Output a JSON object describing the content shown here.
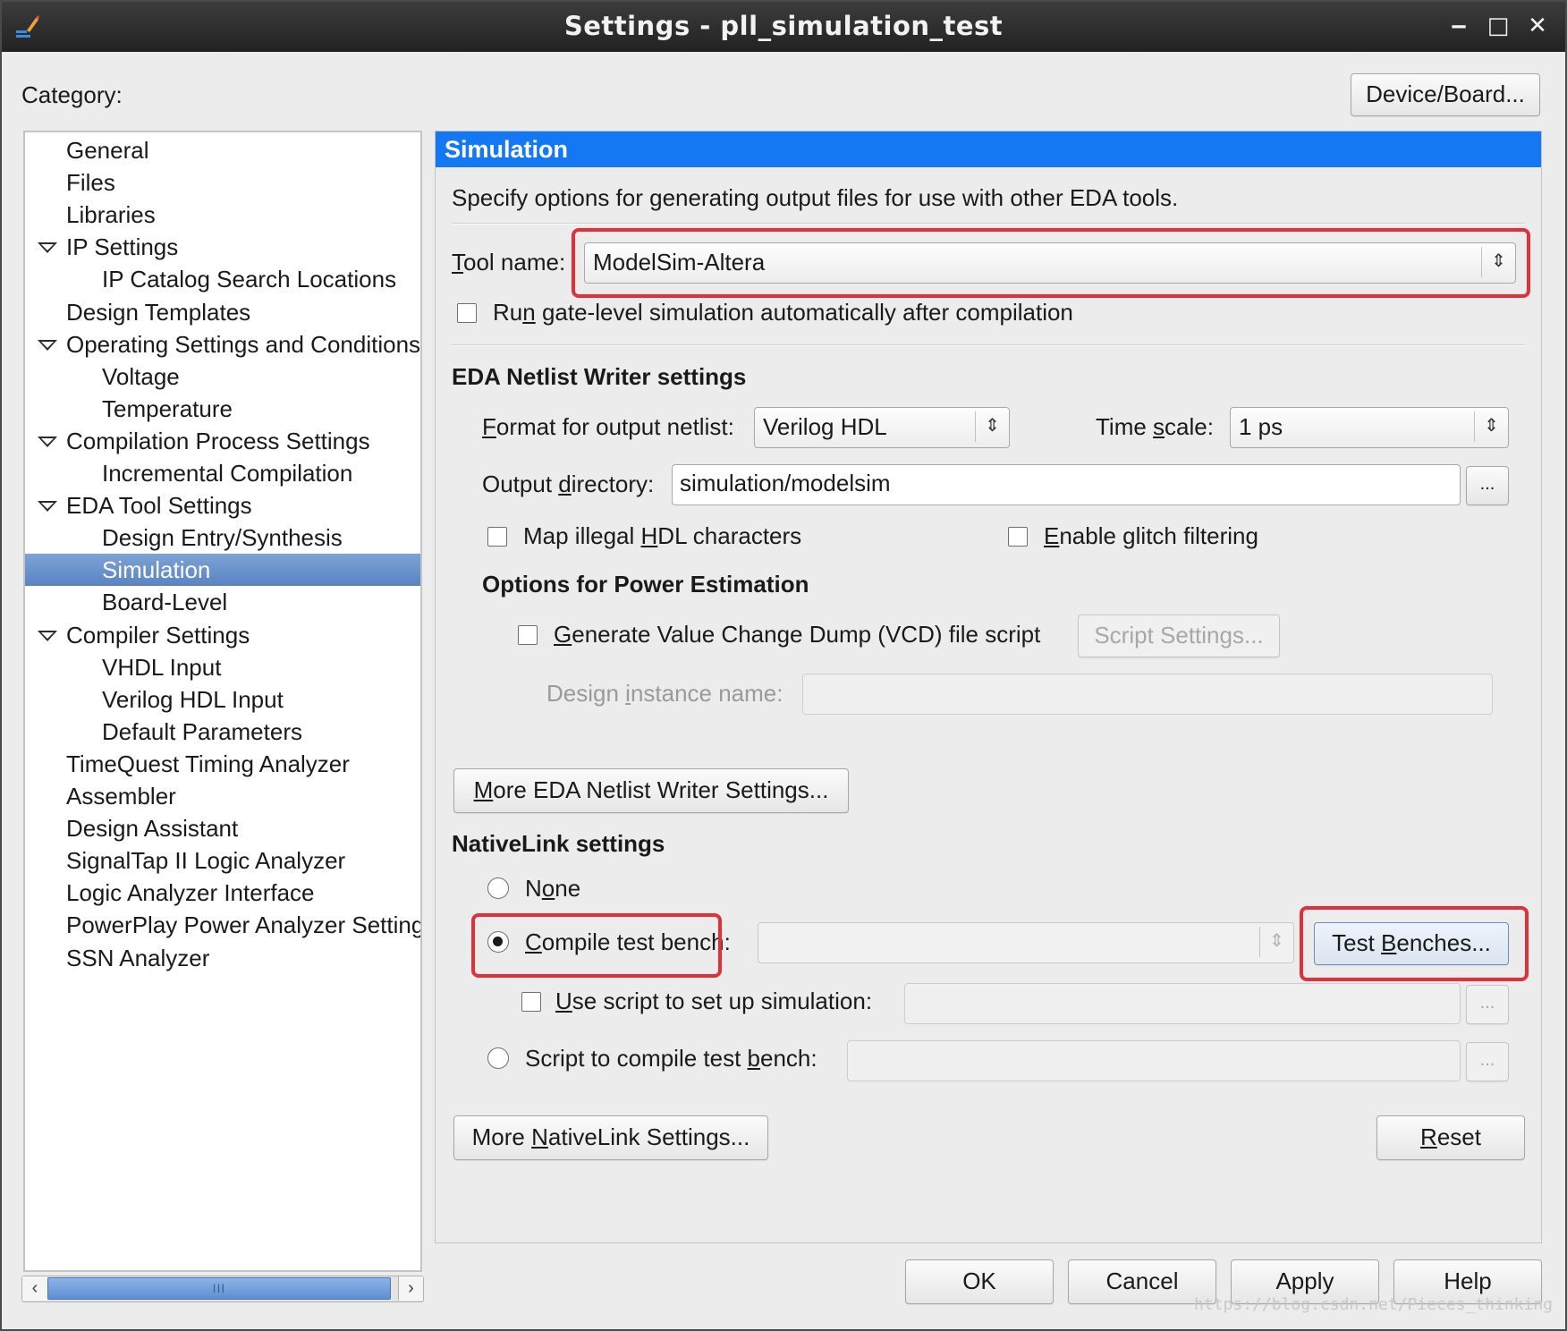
{
  "window": {
    "title": "Settings - pll_simulation_test",
    "minimize_glyph": "‒",
    "maximize_glyph": "□",
    "close_glyph": "✕"
  },
  "category_label": "Category:",
  "device_board_button": "Device/Board...",
  "tree": {
    "items": [
      {
        "label": "General",
        "level": 0
      },
      {
        "label": "Files",
        "level": 0
      },
      {
        "label": "Libraries",
        "level": 0
      },
      {
        "label": "IP Settings",
        "level": 0,
        "expanded": true
      },
      {
        "label": "IP Catalog Search Locations",
        "level": 1
      },
      {
        "label": "Design Templates",
        "level": 0
      },
      {
        "label": "Operating Settings and Conditions",
        "level": 0,
        "expanded": true
      },
      {
        "label": "Voltage",
        "level": 1
      },
      {
        "label": "Temperature",
        "level": 1
      },
      {
        "label": "Compilation Process Settings",
        "level": 0,
        "expanded": true
      },
      {
        "label": "Incremental Compilation",
        "level": 1
      },
      {
        "label": "EDA Tool Settings",
        "level": 0,
        "expanded": true
      },
      {
        "label": "Design Entry/Synthesis",
        "level": 1
      },
      {
        "label": "Simulation",
        "level": 1,
        "selected": true
      },
      {
        "label": "Board-Level",
        "level": 1
      },
      {
        "label": "Compiler Settings",
        "level": 0,
        "expanded": true
      },
      {
        "label": "VHDL Input",
        "level": 1
      },
      {
        "label": "Verilog HDL Input",
        "level": 1
      },
      {
        "label": "Default Parameters",
        "level": 1
      },
      {
        "label": "TimeQuest Timing Analyzer",
        "level": 0
      },
      {
        "label": "Assembler",
        "level": 0
      },
      {
        "label": "Design Assistant",
        "level": 0
      },
      {
        "label": "SignalTap II Logic Analyzer",
        "level": 0
      },
      {
        "label": "Logic Analyzer Interface",
        "level": 0
      },
      {
        "label": "PowerPlay Power Analyzer Settings",
        "level": 0
      },
      {
        "label": "SSN Analyzer",
        "level": 0
      }
    ],
    "scrollbar_grip": "III",
    "scroll_left": "‹",
    "scroll_right": "›"
  },
  "panel": {
    "title": "Simulation",
    "description": "Specify options for generating output files for use with other EDA tools.",
    "tool_name": {
      "label_pre": "",
      "label_ul": "T",
      "label_post": "ool name:",
      "value": "ModelSim-Altera"
    },
    "run_gate_level": {
      "label_pre": "Ru",
      "label_ul": "n",
      "label_post": " gate-level simulation automatically after compilation",
      "checked": false
    },
    "netlist": {
      "heading": "EDA Netlist Writer settings",
      "format_label_pre": "",
      "format_label_ul": "F",
      "format_label_post": "ormat for output netlist:",
      "format_value": "Verilog HDL",
      "timescale_label_pre": "Time ",
      "timescale_label_ul": "s",
      "timescale_label_post": "cale:",
      "timescale_value": "1 ps",
      "output_dir_label_pre": "Output ",
      "output_dir_label_ul": "d",
      "output_dir_label_post": "irectory:",
      "output_dir_value": "simulation/modelsim",
      "browse": "...",
      "map_illegal_pre": "Map illegal ",
      "map_illegal_ul": "H",
      "map_illegal_post": "DL characters",
      "glitch_pre": "",
      "glitch_ul": "E",
      "glitch_post": "nable glitch filtering"
    },
    "power": {
      "heading": "Options for Power Estimation",
      "vcd_pre": "",
      "vcd_ul": "G",
      "vcd_post": "enerate Value Change Dump (VCD) file script",
      "script_settings": "Script Settings...",
      "instance_pre": "Design ",
      "instance_ul": "i",
      "instance_post": "nstance name:",
      "instance_value": ""
    },
    "more_netlist_pre": "",
    "more_netlist_ul": "M",
    "more_netlist_post": "ore EDA Netlist Writer Settings...",
    "nativelink": {
      "heading": "NativeLink settings",
      "none_pre": "N",
      "none_ul": "o",
      "none_post": "ne",
      "compile_pre": "",
      "compile_ul": "C",
      "compile_post": "ompile test bench:",
      "compile_value": "",
      "test_benches_pre": "Test ",
      "test_benches_ul": "B",
      "test_benches_post": "enches...",
      "use_script_pre": "",
      "use_script_ul": "U",
      "use_script_post": "se script to set up simulation:",
      "use_script_value": "",
      "script_compile_pre": "Script to compile test ",
      "script_compile_ul": "b",
      "script_compile_post": "ench:",
      "script_compile_value": "",
      "browse": "...",
      "selected": "compile_test_bench"
    },
    "more_nativelink_pre": "More ",
    "more_nativelink_ul": "N",
    "more_nativelink_post": "ativeLink Settings...",
    "reset_pre": "",
    "reset_ul": "R",
    "reset_post": "eset"
  },
  "footer": {
    "ok": "OK",
    "cancel": "Cancel",
    "apply": "Apply",
    "help": "Help"
  },
  "watermark": "https://blog.csdn.net/Pieces_thinking",
  "colors": {
    "accent_header": "#1478f5",
    "selection": "#5a84c1",
    "annotation": "#e0303a"
  }
}
